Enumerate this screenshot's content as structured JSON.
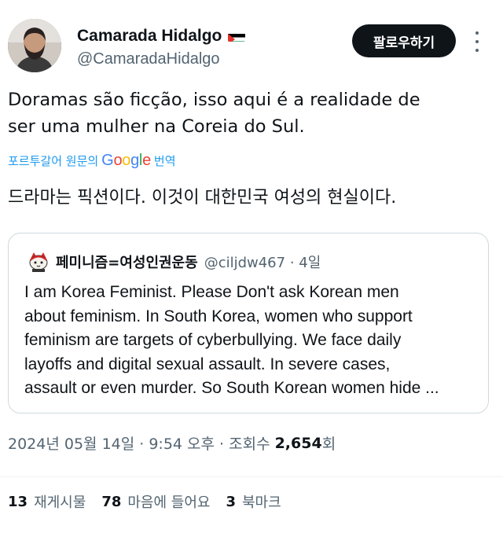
{
  "author": {
    "name": "Camarada Hidalgo",
    "handle": "@CamaradaHidalgo",
    "flag_icon": "palestine-flag-icon"
  },
  "follow_button": {
    "label": "팔로우하기"
  },
  "tweet": {
    "text_line1": "Doramas são ficção, isso aqui é a realidade de",
    "text_line2": "ser uma mulher na Coreia do Sul.",
    "translation_source": "포르투갈어 원문의",
    "google": [
      "G",
      "o",
      "o",
      "g",
      "l",
      "e"
    ],
    "google_colors": [
      "#4285F4",
      "#EA4335",
      "#FBBC05",
      "#4285F4",
      "#34A853",
      "#EA4335"
    ],
    "translate_action": "번역",
    "translated_text": "드라마는 픽션이다. 이것이 대한민국 여성의 현실이다."
  },
  "quote": {
    "name": "페미니즘=여성인권운동",
    "handle_meta": "@ciljdw467 · 4일",
    "lines": [
      "I am Korea Feminist. Please Don't ask Korean men",
      "about feminism. In South Korea, women who support",
      "feminism are targets of cyberbullying. We face daily",
      "layoffs and digital sexual assault. In severe cases,",
      "assault or even murder. So South Korean women hide ..."
    ]
  },
  "meta": {
    "timestamp": "2024년 05월 14일 · 9:54 오후 · 조회수",
    "views": "2,654",
    "views_unit": "회"
  },
  "stats": {
    "reposts_num": "13",
    "reposts_label": "재게시물",
    "likes_num": "78",
    "likes_label": "마음에 들어요",
    "bookmarks_num": "3",
    "bookmarks_label": "북마크"
  },
  "colors": {
    "link": "#1d9bf0",
    "secondary": "#536471",
    "primary_text": "#0f1419",
    "border": "#cfd9de"
  }
}
